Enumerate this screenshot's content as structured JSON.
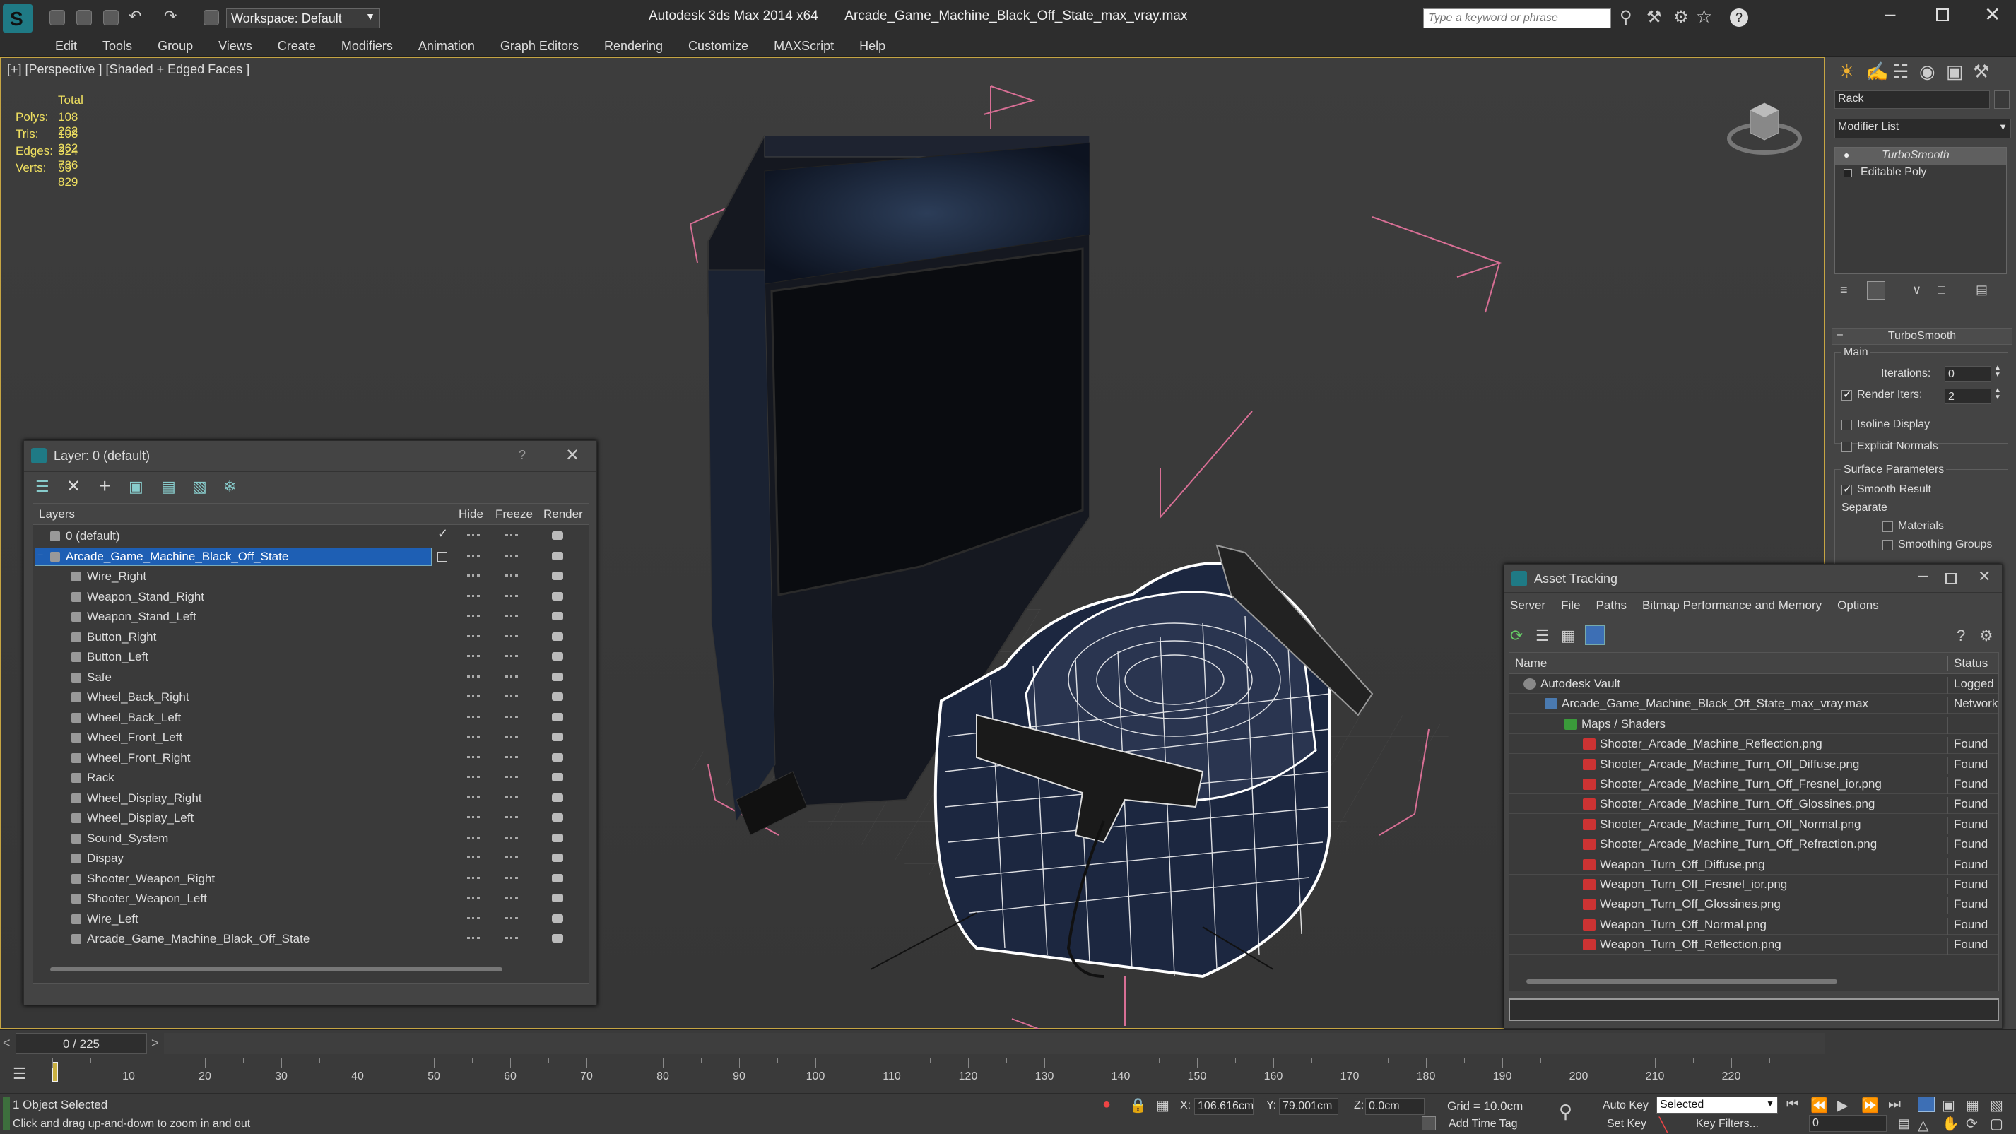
{
  "titlebar": {
    "workspace_label": "Workspace: Default",
    "app_title": "Autodesk 3ds Max  2014 x64",
    "file_title": "Arcade_Game_Machine_Black_Off_State_max_vray.max",
    "search_placeholder": "Type a keyword or phrase"
  },
  "menu": [
    "Edit",
    "Tools",
    "Group",
    "Views",
    "Create",
    "Modifiers",
    "Animation",
    "Graph Editors",
    "Rendering",
    "Customize",
    "MAXScript",
    "Help"
  ],
  "viewport": {
    "label": "[+] [Perspective ] [Shaded + Edged Faces ]",
    "stats": {
      "header": "Total",
      "rows": [
        {
          "label": "Polys:",
          "value": "108 262"
        },
        {
          "label": "Tris:",
          "value": "108 262"
        },
        {
          "label": "Edges:",
          "value": "324 786"
        },
        {
          "label": "Verts:",
          "value": "56 829"
        }
      ]
    }
  },
  "command_panel": {
    "object_name": "Rack",
    "modifier_list": "Modifier List",
    "stack": [
      "TurboSmooth",
      "Editable Poly"
    ],
    "rollout_title": "TurboSmooth",
    "main_label": "Main",
    "iterations_label": "Iterations:",
    "iterations_value": "0",
    "render_iters_label": "Render Iters:",
    "render_iters_value": "2",
    "isoline_label": "Isoline Display",
    "explicit_label": "Explicit Normals",
    "surface_label": "Surface Parameters",
    "smooth_label": "Smooth Result",
    "separate_label": "Separate",
    "materials_label": "Materials",
    "smoothing_label": "Smoothing Groups"
  },
  "layer_dialog": {
    "title": "Layer: 0 (default)",
    "help": "?",
    "columns": {
      "layers": "Layers",
      "hide": "Hide",
      "freeze": "Freeze",
      "render": "Render"
    },
    "rows": [
      {
        "name": "0 (default)",
        "level": 0,
        "type": "layer"
      },
      {
        "name": "Arcade_Game_Machine_Black_Off_State",
        "level": 0,
        "type": "layer",
        "selected": true
      },
      {
        "name": "Wire_Right",
        "level": 1,
        "type": "object"
      },
      {
        "name": "Weapon_Stand_Right",
        "level": 1,
        "type": "object"
      },
      {
        "name": "Weapon_Stand_Left",
        "level": 1,
        "type": "object"
      },
      {
        "name": "Button_Right",
        "level": 1,
        "type": "object"
      },
      {
        "name": "Button_Left",
        "level": 1,
        "type": "object"
      },
      {
        "name": "Safe",
        "level": 1,
        "type": "object"
      },
      {
        "name": "Wheel_Back_Right",
        "level": 1,
        "type": "object"
      },
      {
        "name": "Wheel_Back_Left",
        "level": 1,
        "type": "object"
      },
      {
        "name": "Wheel_Front_Left",
        "level": 1,
        "type": "object"
      },
      {
        "name": "Wheel_Front_Right",
        "level": 1,
        "type": "object"
      },
      {
        "name": "Rack",
        "level": 1,
        "type": "object"
      },
      {
        "name": "Wheel_Display_Right",
        "level": 1,
        "type": "object"
      },
      {
        "name": "Wheel_Display_Left",
        "level": 1,
        "type": "object"
      },
      {
        "name": "Sound_System",
        "level": 1,
        "type": "object"
      },
      {
        "name": "Dispay",
        "level": 1,
        "type": "object"
      },
      {
        "name": "Shooter_Weapon_Right",
        "level": 1,
        "type": "object"
      },
      {
        "name": "Shooter_Weapon_Left",
        "level": 1,
        "type": "object"
      },
      {
        "name": "Wire_Left",
        "level": 1,
        "type": "object"
      },
      {
        "name": "Arcade_Game_Machine_Black_Off_State",
        "level": 1,
        "type": "object"
      }
    ]
  },
  "asset_dialog": {
    "title": "Asset Tracking",
    "menu": [
      "Server",
      "File",
      "Paths",
      "Bitmap Performance and Memory",
      "Options"
    ],
    "columns": {
      "name": "Name",
      "status": "Status"
    },
    "rows": [
      {
        "name": "Autodesk Vault",
        "status": "Logged O",
        "level": 0
      },
      {
        "name": "Arcade_Game_Machine_Black_Off_State_max_vray.max",
        "status": "Network I",
        "level": 1
      },
      {
        "name": "Maps / Shaders",
        "status": "",
        "level": 2
      },
      {
        "name": "Shooter_Arcade_Machine_Reflection.png",
        "status": "Found",
        "level": 3
      },
      {
        "name": "Shooter_Arcade_Machine_Turn_Off_Diffuse.png",
        "status": "Found",
        "level": 3
      },
      {
        "name": "Shooter_Arcade_Machine_Turn_Off_Fresnel_ior.png",
        "status": "Found",
        "level": 3
      },
      {
        "name": "Shooter_Arcade_Machine_Turn_Off_Glossines.png",
        "status": "Found",
        "level": 3
      },
      {
        "name": "Shooter_Arcade_Machine_Turn_Off_Normal.png",
        "status": "Found",
        "level": 3
      },
      {
        "name": "Shooter_Arcade_Machine_Turn_Off_Refraction.png",
        "status": "Found",
        "level": 3
      },
      {
        "name": "Weapon_Turn_Off_Diffuse.png",
        "status": "Found",
        "level": 3
      },
      {
        "name": "Weapon_Turn_Off_Fresnel_ior.png",
        "status": "Found",
        "level": 3
      },
      {
        "name": "Weapon_Turn_Off_Glossines.png",
        "status": "Found",
        "level": 3
      },
      {
        "name": "Weapon_Turn_Off_Normal.png",
        "status": "Found",
        "level": 3
      },
      {
        "name": "Weapon_Turn_Off_Reflection.png",
        "status": "Found",
        "level": 3
      }
    ]
  },
  "timeline": {
    "frame_label": "0 / 225",
    "ticks": [
      "10",
      "20",
      "30",
      "40",
      "50",
      "60",
      "70",
      "80",
      "90",
      "100",
      "110",
      "120",
      "130",
      "140",
      "150",
      "160",
      "170",
      "180",
      "190",
      "200",
      "210",
      "220"
    ]
  },
  "status": {
    "selection": "1 Object Selected",
    "prompt": "Click and drag up-and-down to zoom in and out",
    "x_label": "X:",
    "x_value": "106.616cm",
    "y_label": "Y:",
    "y_value": "79.001cm",
    "z_label": "Z:",
    "z_value": "0.0cm",
    "grid": "Grid = 10.0cm",
    "add_time_tag": "Add Time Tag",
    "auto_key": "Auto Key",
    "selected_option": "Selected",
    "set_key": "Set Key",
    "key_filters": "Key Filters...",
    "frame_value": "0"
  }
}
